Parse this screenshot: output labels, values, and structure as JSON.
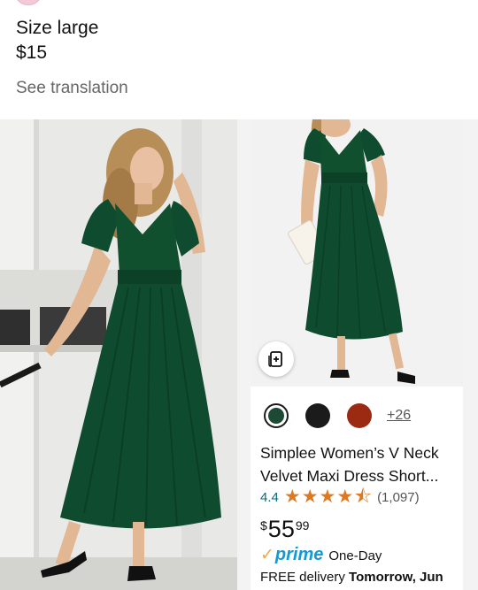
{
  "listing": {
    "title": "Size large",
    "price": "$15",
    "see_translation": "See translation"
  },
  "product": {
    "color_more": "+26",
    "name": "Simplee Women’s V Neck Velvet Maxi Dress Short...",
    "rating": "4.4",
    "stars": 4.5,
    "review_count": "(1,097)",
    "price_symbol": "$",
    "price_whole": "55",
    "price_cents": "99",
    "prime_label": "prime",
    "prime_speed": "One-Day",
    "delivery_prefix": "FREE delivery ",
    "delivery_date": "Tomorrow, Jun",
    "swatch_colors": [
      "#1d4a34",
      "#1b1b1b",
      "#9c2a12"
    ]
  },
  "colors": {
    "dress_green": "#0f4b2f",
    "star_orange": "#de7921",
    "prime_blue": "#1399d5"
  }
}
